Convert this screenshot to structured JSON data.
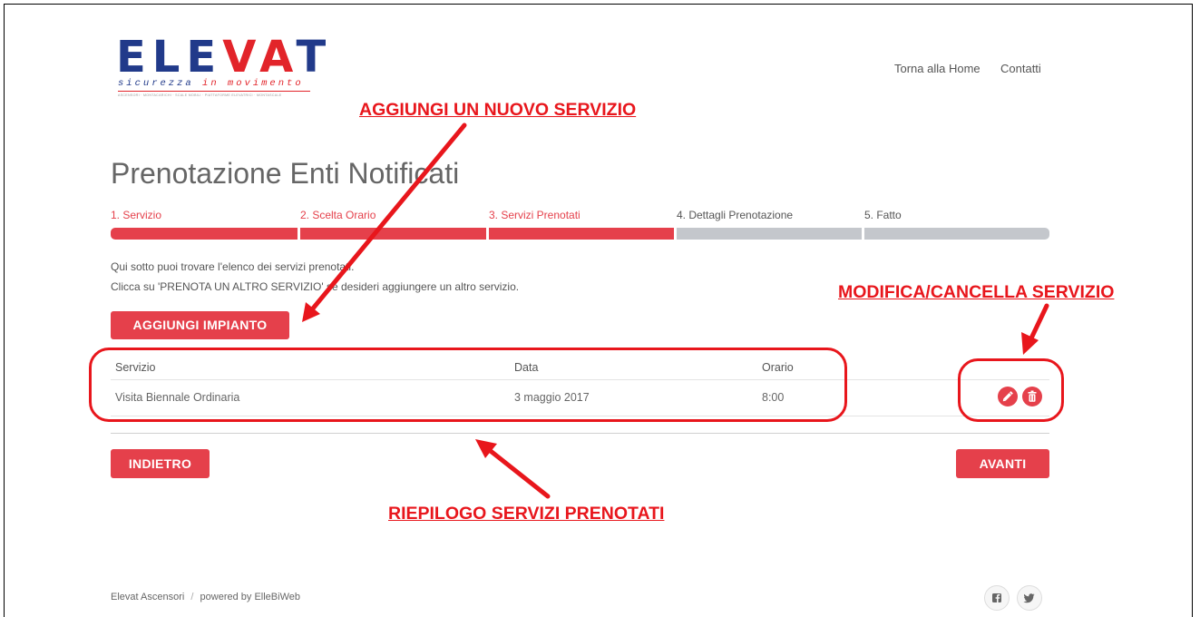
{
  "logo": {
    "letters": [
      "E",
      "L",
      "E",
      "V",
      "A",
      "T"
    ],
    "tagline_1": "sicurezza ",
    "tagline_2": "in movimento",
    "subline": "ASCENSORI · MONTACARICHI · SCALE MOBILI · PIATTAFORME ELEVATRICI · MONTASCALE"
  },
  "nav": {
    "home": "Torna alla Home",
    "contacts": "Contatti"
  },
  "page_title": "Prenotazione Enti Notificati",
  "steps": [
    {
      "label": "1. Servizio",
      "active": true
    },
    {
      "label": "2. Scelta Orario",
      "active": true
    },
    {
      "label": "3. Servizi Prenotati",
      "active": true
    },
    {
      "label": "4. Dettagli Prenotazione",
      "active": false
    },
    {
      "label": "5. Fatto",
      "active": false
    }
  ],
  "description": {
    "line1": "Qui sotto puoi trovare l'elenco dei servizi prenotati.",
    "line2": "Clicca su 'PRENOTA UN ALTRO SERVIZIO' se desideri aggiungere un altro servizio."
  },
  "add_button": "AGGIUNGI IMPIANTO",
  "table": {
    "headers": [
      "Servizio",
      "Data",
      "Orario"
    ],
    "rows": [
      {
        "servizio": "Visita Biennale Ordinaria",
        "data": "3 maggio 2017",
        "orario": "8:00"
      }
    ]
  },
  "icons": {
    "edit": "pencil-icon",
    "delete": "trash-icon",
    "facebook": "facebook-icon",
    "twitter": "twitter-icon"
  },
  "back_button": "INDIETRO",
  "next_button": "AVANTI",
  "footer": {
    "company": "Elevat Ascensori",
    "separator": "/",
    "powered": "powered by ElleBiWeb"
  },
  "annotations": {
    "add_service": "AGGIUNGI UN NUOVO SERVIZIO",
    "edit_delete": "MODIFICA/CANCELLA SERVIZIO",
    "summary": "RIEPILOGO SERVIZI PRENOTATI"
  },
  "colors": {
    "accent": "#e5404b",
    "step_inactive": "#c4c7cc",
    "annotation": "#e8161c",
    "logo_blue": "#213a8a",
    "logo_red": "#e2242a"
  }
}
